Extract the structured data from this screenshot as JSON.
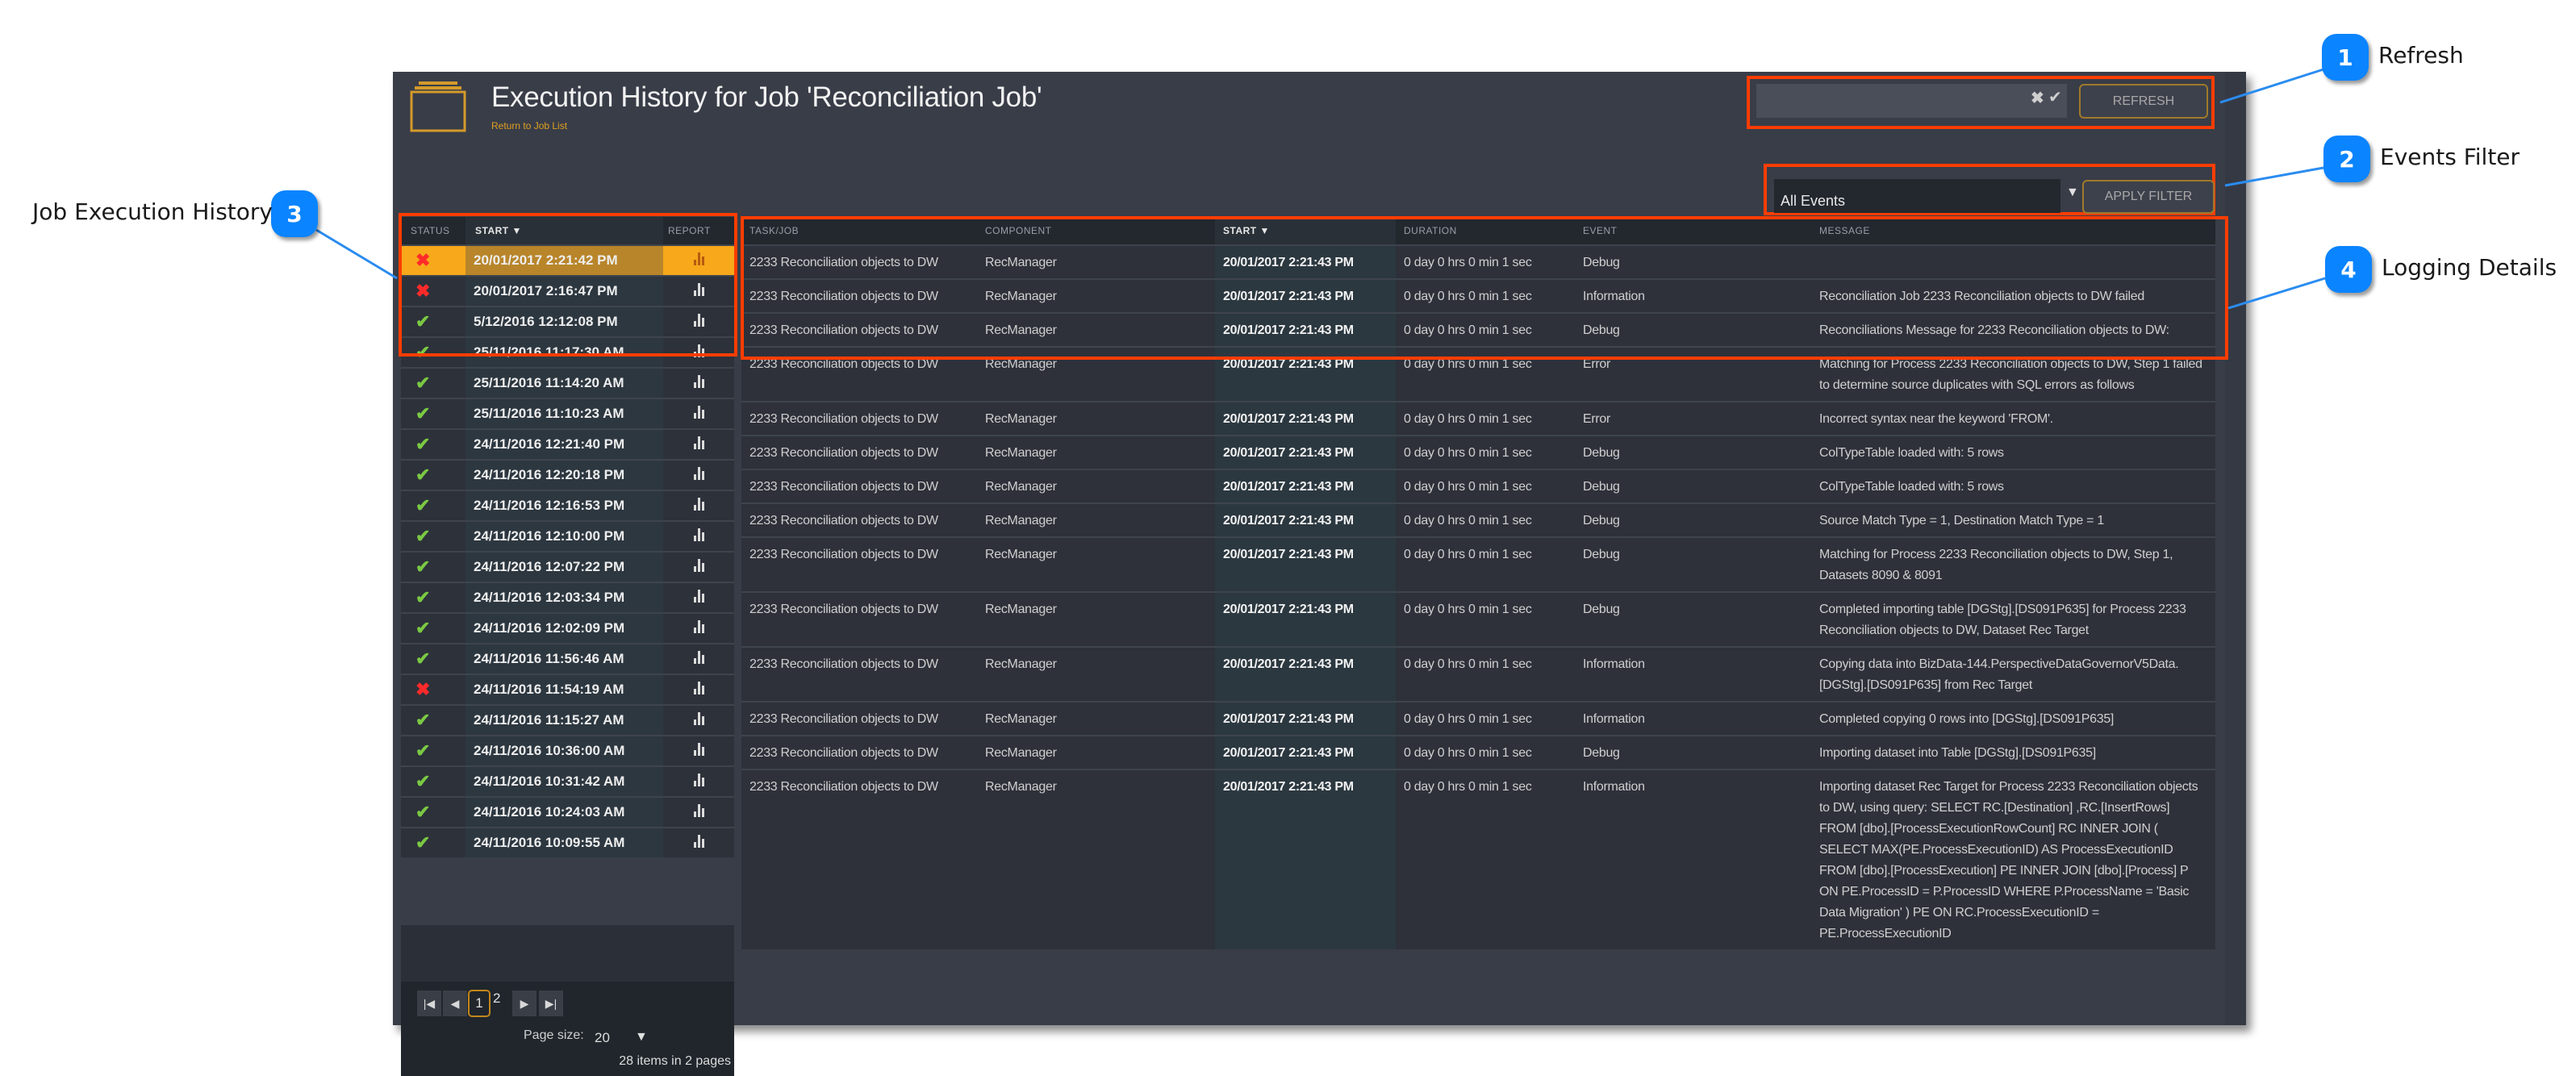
{
  "header": {
    "title": "Execution History for Job 'Reconciliation Job'",
    "return_link": "Return to Job List",
    "icon": "job-stack-icon"
  },
  "refresh": {
    "input_value": "",
    "clear_icon": "✖",
    "confirm_icon": "✔",
    "button_label": "REFRESH"
  },
  "filter": {
    "selected": "All Events",
    "caret": "▼",
    "button_label": "APPLY FILTER"
  },
  "executions": {
    "columns": [
      "STATUS",
      "START ▼",
      "REPORT"
    ],
    "rows": [
      {
        "status": "fail",
        "start": "20/01/2017 2:21:42 PM",
        "selected": true
      },
      {
        "status": "fail",
        "start": "20/01/2017 2:16:47 PM"
      },
      {
        "status": "ok",
        "start": "5/12/2016 12:12:08 PM"
      },
      {
        "status": "ok",
        "start": "25/11/2016 11:17:30 AM"
      },
      {
        "status": "ok",
        "start": "25/11/2016 11:14:20 AM"
      },
      {
        "status": "ok",
        "start": "25/11/2016 11:10:23 AM"
      },
      {
        "status": "ok",
        "start": "24/11/2016 12:21:40 PM"
      },
      {
        "status": "ok",
        "start": "24/11/2016 12:20:18 PM"
      },
      {
        "status": "ok",
        "start": "24/11/2016 12:16:53 PM"
      },
      {
        "status": "ok",
        "start": "24/11/2016 12:10:00 PM"
      },
      {
        "status": "ok",
        "start": "24/11/2016 12:07:22 PM"
      },
      {
        "status": "ok",
        "start": "24/11/2016 12:03:34 PM"
      },
      {
        "status": "ok",
        "start": "24/11/2016 12:02:09 PM"
      },
      {
        "status": "ok",
        "start": "24/11/2016 11:56:46 AM"
      },
      {
        "status": "fail",
        "start": "24/11/2016 11:54:19 AM"
      },
      {
        "status": "ok",
        "start": "24/11/2016 11:15:27 AM"
      },
      {
        "status": "ok",
        "start": "24/11/2016 10:36:00 AM"
      },
      {
        "status": "ok",
        "start": "24/11/2016 10:31:42 AM"
      },
      {
        "status": "ok",
        "start": "24/11/2016 10:24:03 AM"
      },
      {
        "status": "ok",
        "start": "24/11/2016 10:09:55 AM"
      }
    ],
    "status_icons": {
      "ok": "✔",
      "fail": "✖"
    },
    "colors": {
      "ok": "#7ac943",
      "fail": "#ff2a2a",
      "selected": "#f7a81b"
    }
  },
  "pager": {
    "first": "|◀",
    "prev": "◀",
    "pages": [
      "1",
      "2"
    ],
    "current_page": "1",
    "next": "▶",
    "last": "▶|",
    "page_size_label": "Page size:",
    "page_size": "20",
    "page_size_caret": "▼",
    "items_info": "28 items in 2 pages"
  },
  "logs": {
    "columns": [
      "TASK/JOB",
      "COMPONENT",
      "START ▼",
      "DURATION",
      "EVENT",
      "MESSAGE"
    ],
    "rows": [
      {
        "task": "2233 Reconciliation objects to DW",
        "component": "RecManager",
        "start": "20/01/2017 2:21:43 PM",
        "duration": "0 day 0 hrs 0 min 1 sec",
        "event": "Debug",
        "message": ""
      },
      {
        "task": "2233 Reconciliation objects to DW",
        "component": "RecManager",
        "start": "20/01/2017 2:21:43 PM",
        "duration": "0 day 0 hrs 0 min 1 sec",
        "event": "Information",
        "message": "Reconciliation Job 2233 Reconciliation objects to DW failed"
      },
      {
        "task": "2233 Reconciliation objects to DW",
        "component": "RecManager",
        "start": "20/01/2017 2:21:43 PM",
        "duration": "0 day 0 hrs 0 min 1 sec",
        "event": "Debug",
        "message": "Reconciliations Message for 2233 Reconciliation objects to DW:"
      },
      {
        "task": "2233 Reconciliation objects to DW",
        "component": "RecManager",
        "start": "20/01/2017 2:21:43 PM",
        "duration": "0 day 0 hrs 0 min 1 sec",
        "event": "Error",
        "message": "Matching for Process 2233 Reconciliation objects to DW, Step 1 failed to determine source duplicates with SQL errors as follows"
      },
      {
        "task": "2233 Reconciliation objects to DW",
        "component": "RecManager",
        "start": "20/01/2017 2:21:43 PM",
        "duration": "0 day 0 hrs 0 min 1 sec",
        "event": "Error",
        "message": "Incorrect syntax near the keyword 'FROM'."
      },
      {
        "task": "2233 Reconciliation objects to DW",
        "component": "RecManager",
        "start": "20/01/2017 2:21:43 PM",
        "duration": "0 day 0 hrs 0 min 1 sec",
        "event": "Debug",
        "message": "ColTypeTable loaded with: 5 rows"
      },
      {
        "task": "2233 Reconciliation objects to DW",
        "component": "RecManager",
        "start": "20/01/2017 2:21:43 PM",
        "duration": "0 day 0 hrs 0 min 1 sec",
        "event": "Debug",
        "message": "ColTypeTable loaded with: 5 rows"
      },
      {
        "task": "2233 Reconciliation objects to DW",
        "component": "RecManager",
        "start": "20/01/2017 2:21:43 PM",
        "duration": "0 day 0 hrs 0 min 1 sec",
        "event": "Debug",
        "message": "Source Match Type = 1, Destination Match Type = 1"
      },
      {
        "task": "2233 Reconciliation objects to DW",
        "component": "RecManager",
        "start": "20/01/2017 2:21:43 PM",
        "duration": "0 day 0 hrs 0 min 1 sec",
        "event": "Debug",
        "message": "Matching for Process 2233 Reconciliation objects to DW, Step 1, Datasets 8090 & 8091"
      },
      {
        "task": "2233 Reconciliation objects to DW",
        "component": "RecManager",
        "start": "20/01/2017 2:21:43 PM",
        "duration": "0 day 0 hrs 0 min 1 sec",
        "event": "Debug",
        "message": "Completed importing table [DGStg].[DS091P635] for Process 2233 Reconciliation objects to DW, Dataset Rec Target"
      },
      {
        "task": "2233 Reconciliation objects to DW",
        "component": "RecManager",
        "start": "20/01/2017 2:21:43 PM",
        "duration": "0 day 0 hrs 0 min 1 sec",
        "event": "Information",
        "message": "Copying data into BizData-144.PerspectiveDataGovernorV5Data.[DGStg].[DS091P635] from Rec Target"
      },
      {
        "task": "2233 Reconciliation objects to DW",
        "component": "RecManager",
        "start": "20/01/2017 2:21:43 PM",
        "duration": "0 day 0 hrs 0 min 1 sec",
        "event": "Information",
        "message": "Completed copying 0 rows into [DGStg].[DS091P635]"
      },
      {
        "task": "2233 Reconciliation objects to DW",
        "component": "RecManager",
        "start": "20/01/2017 2:21:43 PM",
        "duration": "0 day 0 hrs 0 min 1 sec",
        "event": "Debug",
        "message": "Importing dataset into Table [DGStg].[DS091P635]"
      },
      {
        "task": "2233 Reconciliation objects to DW",
        "component": "RecManager",
        "start": "20/01/2017 2:21:43 PM",
        "duration": "0 day 0 hrs 0 min 1 sec",
        "event": "Information",
        "message": "Importing dataset Rec Target for Process 2233 Reconciliation objects to DW, using query: SELECT RC.[Destination] ,RC.[InsertRows] FROM [dbo].[ProcessExecutionRowCount] RC INNER JOIN ( SELECT MAX(PE.ProcessExecutionID) AS ProcessExecutionID FROM [dbo].[ProcessExecution] PE INNER JOIN [dbo].[Process] P ON PE.ProcessID = P.ProcessID WHERE P.ProcessName = 'Basic Data Migration' ) PE ON RC.ProcessExecutionID = PE.ProcessExecutionID"
      }
    ],
    "event_colors": {
      "Debug": "#e8e8e8",
      "Information": "#6cc04a",
      "Error": "#e11b1b"
    }
  },
  "callouts": [
    {
      "number": "1",
      "label": "Refresh"
    },
    {
      "number": "2",
      "label": "Events Filter"
    },
    {
      "number": "3",
      "label": "Job Execution History"
    },
    {
      "number": "4",
      "label": "Logging Details"
    }
  ],
  "highlight_color": "#ff3d00"
}
